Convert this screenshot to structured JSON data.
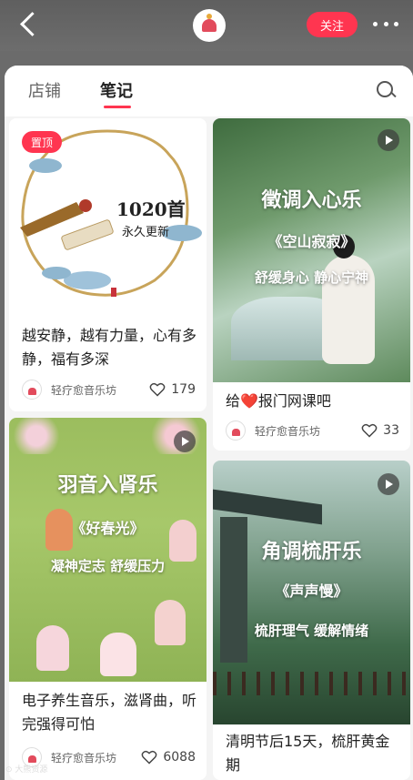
{
  "header": {
    "follow_label": "关注",
    "brand_color": "#ff3550"
  },
  "tabs": [
    {
      "label": "店铺",
      "active": false
    },
    {
      "label": "笔记",
      "active": true
    }
  ],
  "icons": [
    "back-icon",
    "brand-logo-icon",
    "more-icon",
    "search-icon",
    "play-icon",
    "heart-icon"
  ],
  "notes": [
    {
      "pinned_label": "置顶",
      "image_text_main": "1020首",
      "image_text_sub": "永久更新",
      "title": "越安静，越有力量，心有多静，福有多深",
      "author": "轻疗愈音乐坊",
      "likes": "179",
      "is_video": false
    },
    {
      "image_title": "徵调入心乐",
      "image_subtitle": "《空山寂寂》",
      "image_caption": "舒缓身心  静心宁神",
      "title": "给❤️报门网课吧",
      "author": "轻疗愈音乐坊",
      "likes": "33",
      "is_video": true
    },
    {
      "image_title": "羽音入肾乐",
      "image_subtitle": "《好春光》",
      "image_caption": "凝神定志  舒缓压力",
      "title": "电子养生音乐，滋肾曲，听完强得可怕",
      "author": "轻疗愈音乐坊",
      "likes": "6088",
      "is_video": true
    },
    {
      "image_title": "角调梳肝乐",
      "image_subtitle": "《声声慢》",
      "image_caption": "梳肝理气  缓解情绪",
      "title": "清明节后15天，梳肝黄金期",
      "is_video": true
    }
  ],
  "watermark": "⊙ 大熊资源"
}
